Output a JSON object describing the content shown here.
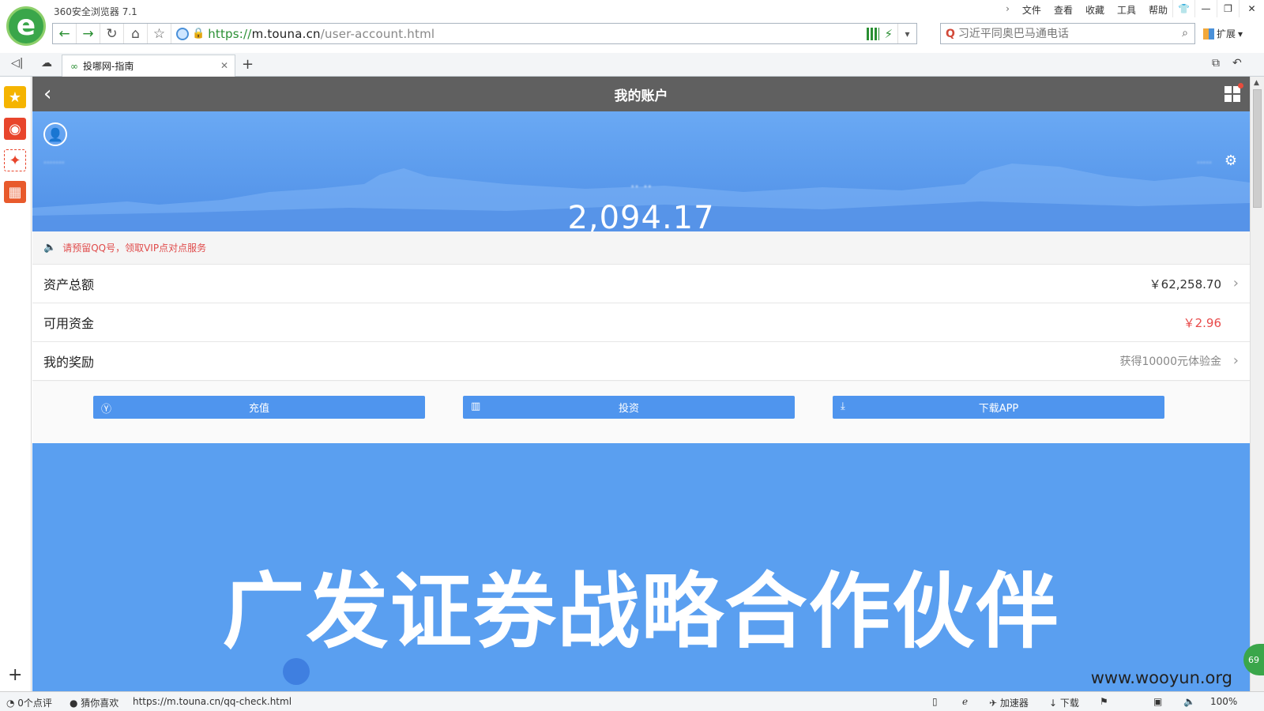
{
  "browser": {
    "app_title": "360安全浏览器 7.1",
    "menu": [
      "文件",
      "查看",
      "收藏",
      "工具",
      "帮助"
    ],
    "url": {
      "proto": "https://",
      "host": "m.touna.cn",
      "path": "/user-account.html"
    },
    "search_placeholder": "习近平同奥巴马通电话",
    "extensions_label": "扩展",
    "tab_title": "投哪网-指南"
  },
  "page": {
    "header_title": "我的账户",
    "user_blurred": "·······",
    "right_blurred": "·····",
    "balance_label": "·· ··",
    "balance_value": "2,094.17",
    "notice": "请预留QQ号，领取VIP点对点服务",
    "rows": [
      {
        "label": "资产总额",
        "value": "￥62,258.70",
        "style": "normal",
        "chevron": true
      },
      {
        "label": "可用资金",
        "value": "￥2.96",
        "style": "red",
        "chevron": false
      },
      {
        "label": "我的奖励",
        "value": "获得10000元体验金",
        "style": "gray",
        "chevron": true
      }
    ],
    "buttons": [
      {
        "label": "充值",
        "icon": "yen-circle-icon"
      },
      {
        "label": "投资",
        "icon": "bar-chart-icon"
      },
      {
        "label": "下载APP",
        "icon": "download-icon"
      }
    ],
    "promo_text": "广发证券战略合作伙伴"
  },
  "statusbar": {
    "comments": "0个点评",
    "guess": "猜你喜欢",
    "hover_url": "https://m.touna.cn/qq-check.html",
    "accelerator": "加速器",
    "download": "下载",
    "zoom": "100%",
    "badge": "69"
  },
  "watermark": "www.wooyun.org",
  "colors": {
    "header": "#606060",
    "banner": "#5a9ff0",
    "button": "#4f95ee",
    "notice": "#e04b4b",
    "accent_green": "#3aa64a"
  }
}
